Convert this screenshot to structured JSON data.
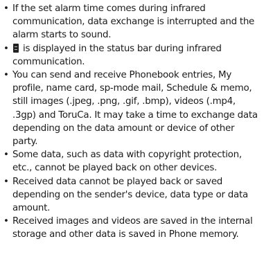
{
  "bullet_char": "•",
  "notes": [
    {
      "text": "If the set alarm time comes during infrared communication, data exchange is interrupted and the alarm starts to sound."
    },
    {
      "text": " is displayed in the status bar during infrared communication.",
      "icon": "infrared-status-icon"
    },
    {
      "text": "You can send and receive Phonebook entries, My profile, name card, sp-mode mail, Schedule & memo, still images (.jpeg, .png, .gif, .bmp), videos (.mp4, .3gp) and ToruCa. It may take a time to exchange data depending on the data amount or device of other party."
    },
    {
      "text": "Some data, such as data with copyright protection, etc., cannot be played back on other devices."
    },
    {
      "text": "Received data cannot be played back or saved depending on the sender's device, data type or data amount."
    },
    {
      "text": "Received images and videos are saved in the internal storage and other data is saved in Phone memory."
    }
  ]
}
